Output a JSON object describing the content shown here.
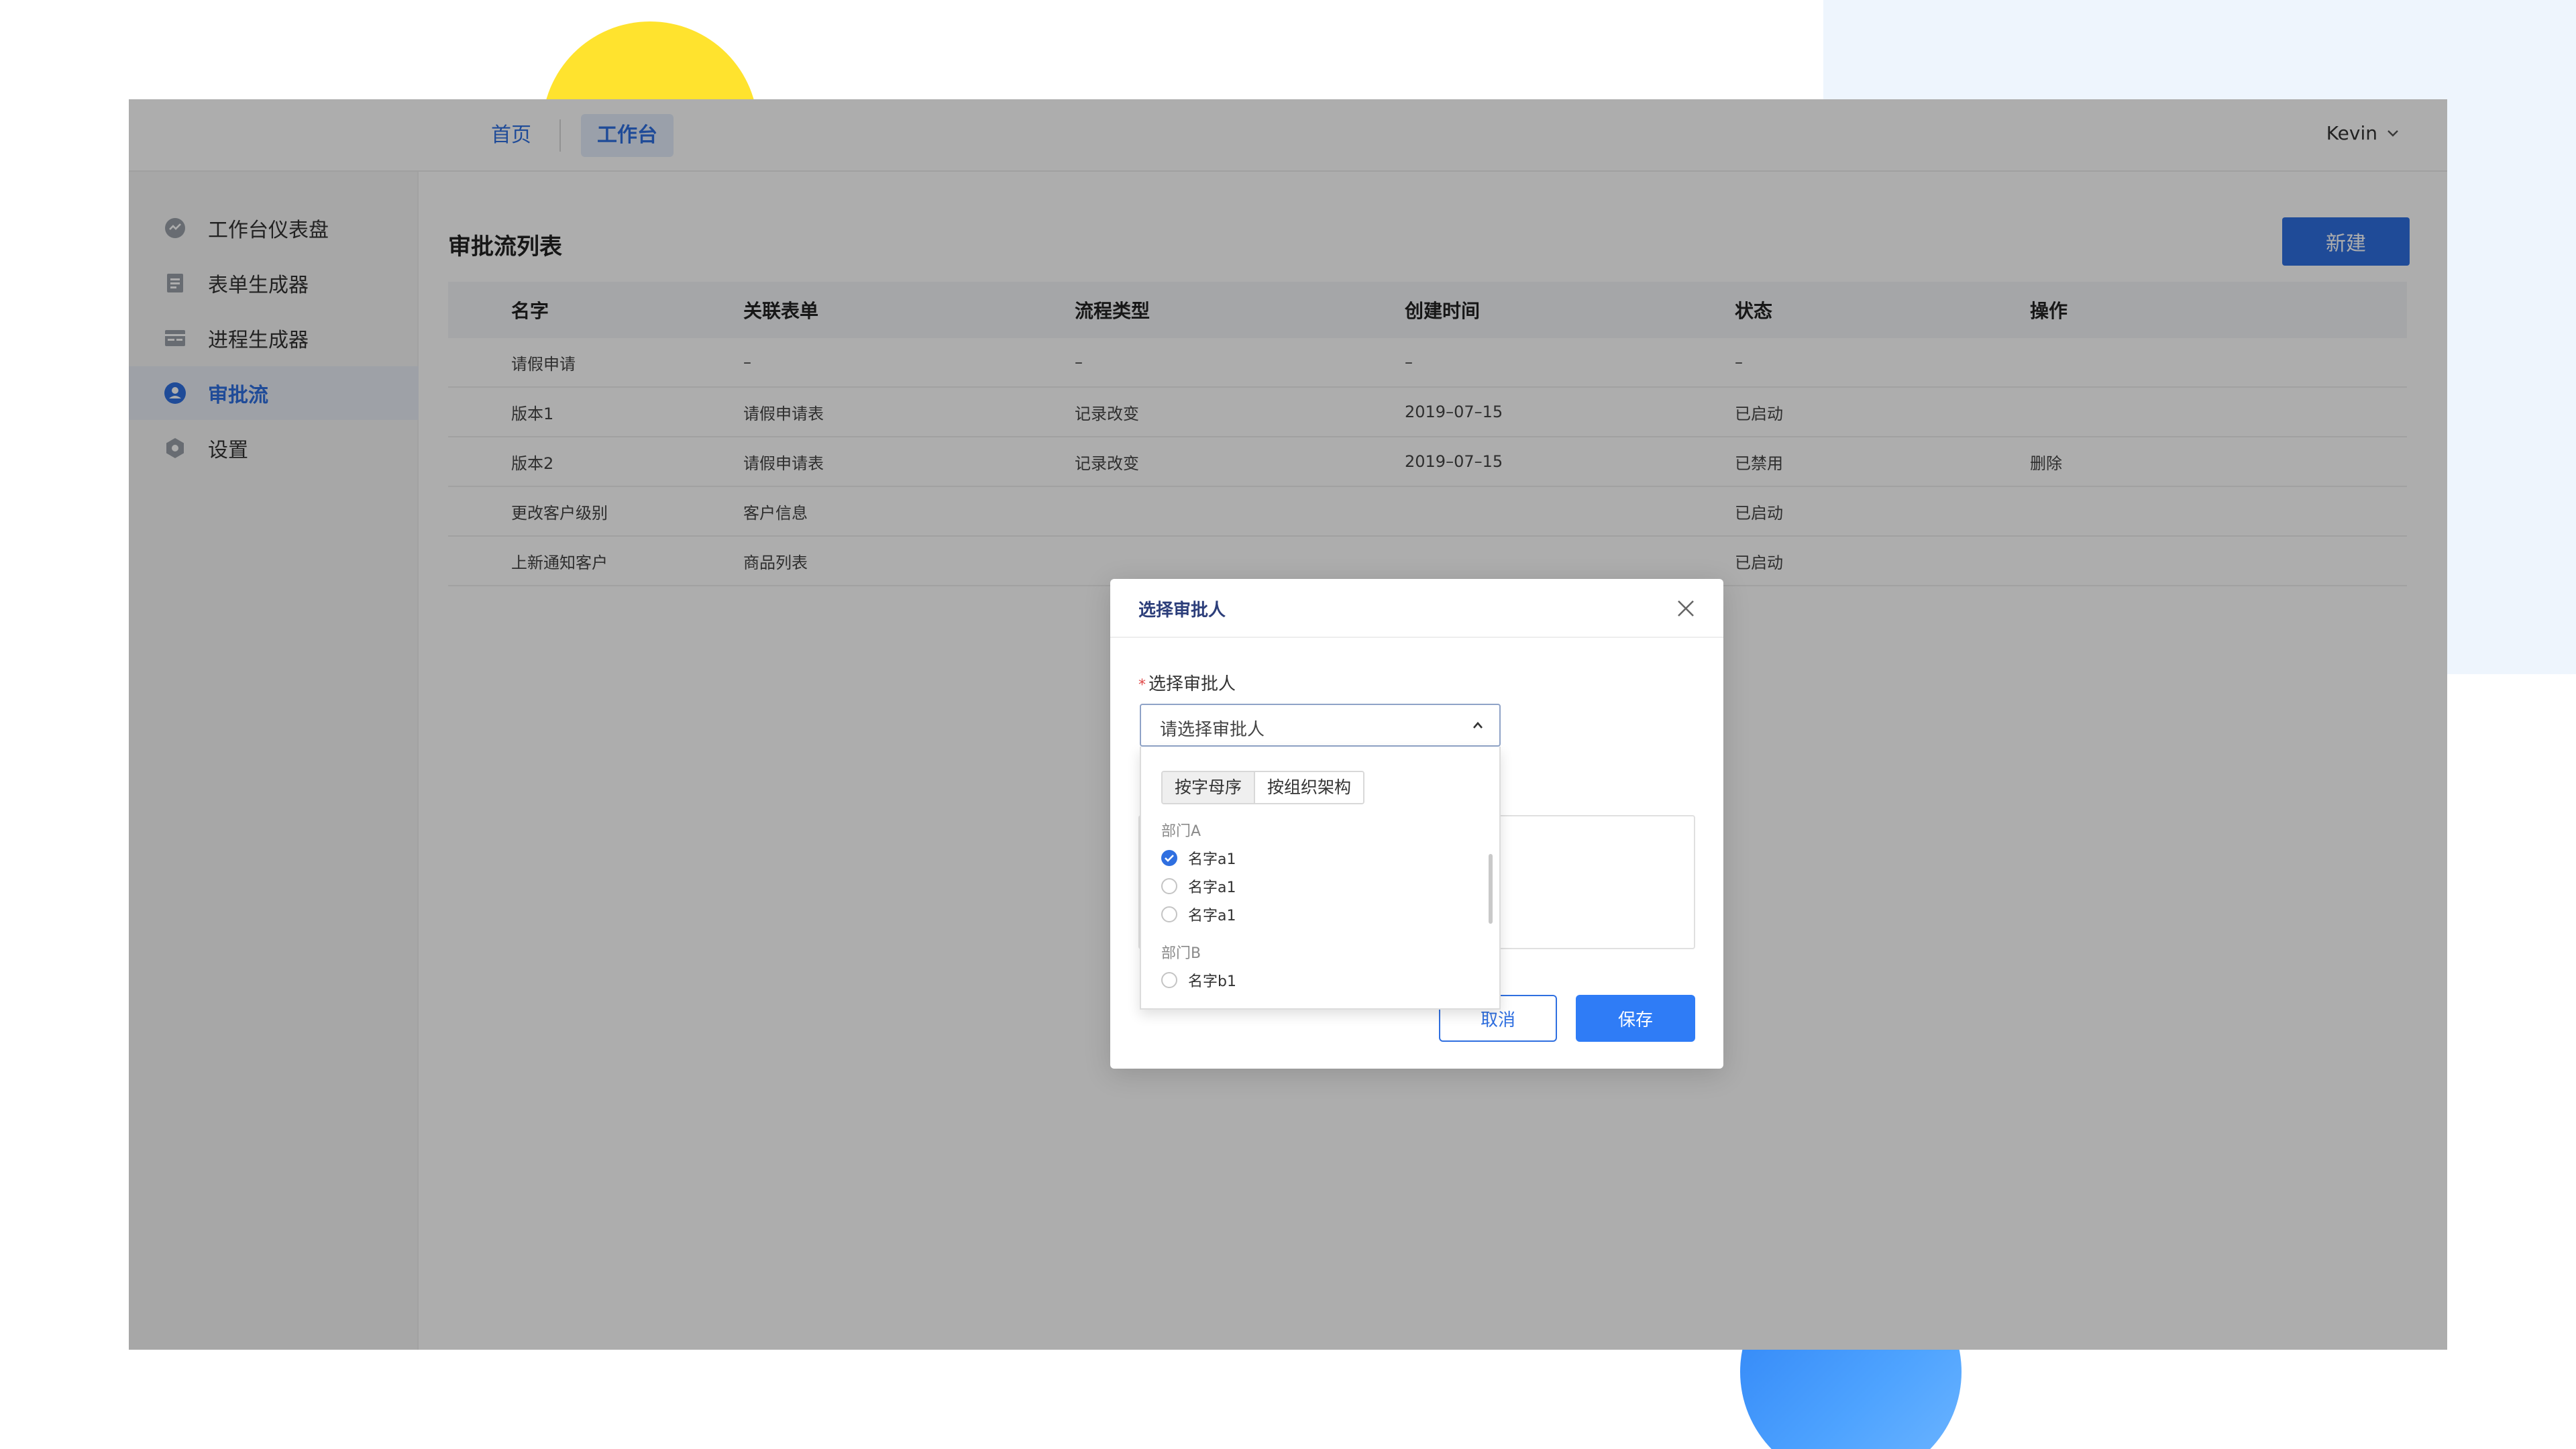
{
  "topbar": {
    "nav": [
      "首页",
      "工作台"
    ],
    "user_name": "Kevin"
  },
  "sidebar": {
    "items": [
      {
        "label": "工作台仪表盘",
        "icon": "dashboard-icon"
      },
      {
        "label": "表单生成器",
        "icon": "form-icon"
      },
      {
        "label": "进程生成器",
        "icon": "process-icon"
      },
      {
        "label": "审批流",
        "icon": "approval-icon",
        "active": true
      },
      {
        "label": "设置",
        "icon": "settings-icon"
      }
    ]
  },
  "page": {
    "title": "审批流列表",
    "new_button": "新建"
  },
  "table": {
    "columns": [
      "名字",
      "关联表单",
      "流程类型",
      "创建时间",
      "状态",
      "操作"
    ],
    "rows": [
      [
        "请假申请",
        "–",
        "–",
        "–",
        "–",
        ""
      ],
      [
        "版本1",
        "请假申请表",
        "记录改变",
        "2019–07–15",
        "已启动",
        ""
      ],
      [
        "版本2",
        "请假申请表",
        "记录改变",
        "2019–07–15",
        "已禁用",
        "删除"
      ],
      [
        "更改客户级别",
        "客户信息",
        "",
        "",
        "已启动",
        ""
      ],
      [
        "上新通知客户",
        "商品列表",
        "",
        "",
        "已启动",
        ""
      ]
    ]
  },
  "modal": {
    "title": "选择审批人",
    "field_label": "选择审批人",
    "required_mark": "*",
    "select_placeholder": "请选择审批人",
    "cancel": "取消",
    "save": "保存",
    "dropdown": {
      "tabs": [
        "按字母序",
        "按组织架构"
      ],
      "selected_tab": "按字母序",
      "groups": [
        {
          "label": "部门A",
          "options": [
            {
              "label": "名字a1",
              "checked": true
            },
            {
              "label": "名字a1",
              "checked": false
            },
            {
              "label": "名字a1",
              "checked": false
            }
          ]
        },
        {
          "label": "部门B",
          "options": [
            {
              "label": "名字b1",
              "checked": false
            }
          ]
        }
      ]
    }
  },
  "colors": {
    "accent": "#2f6fe0",
    "save_button": "#2f7cf6",
    "deco_yellow": "#ffe32e",
    "deco_blue": "#2d82f5"
  }
}
